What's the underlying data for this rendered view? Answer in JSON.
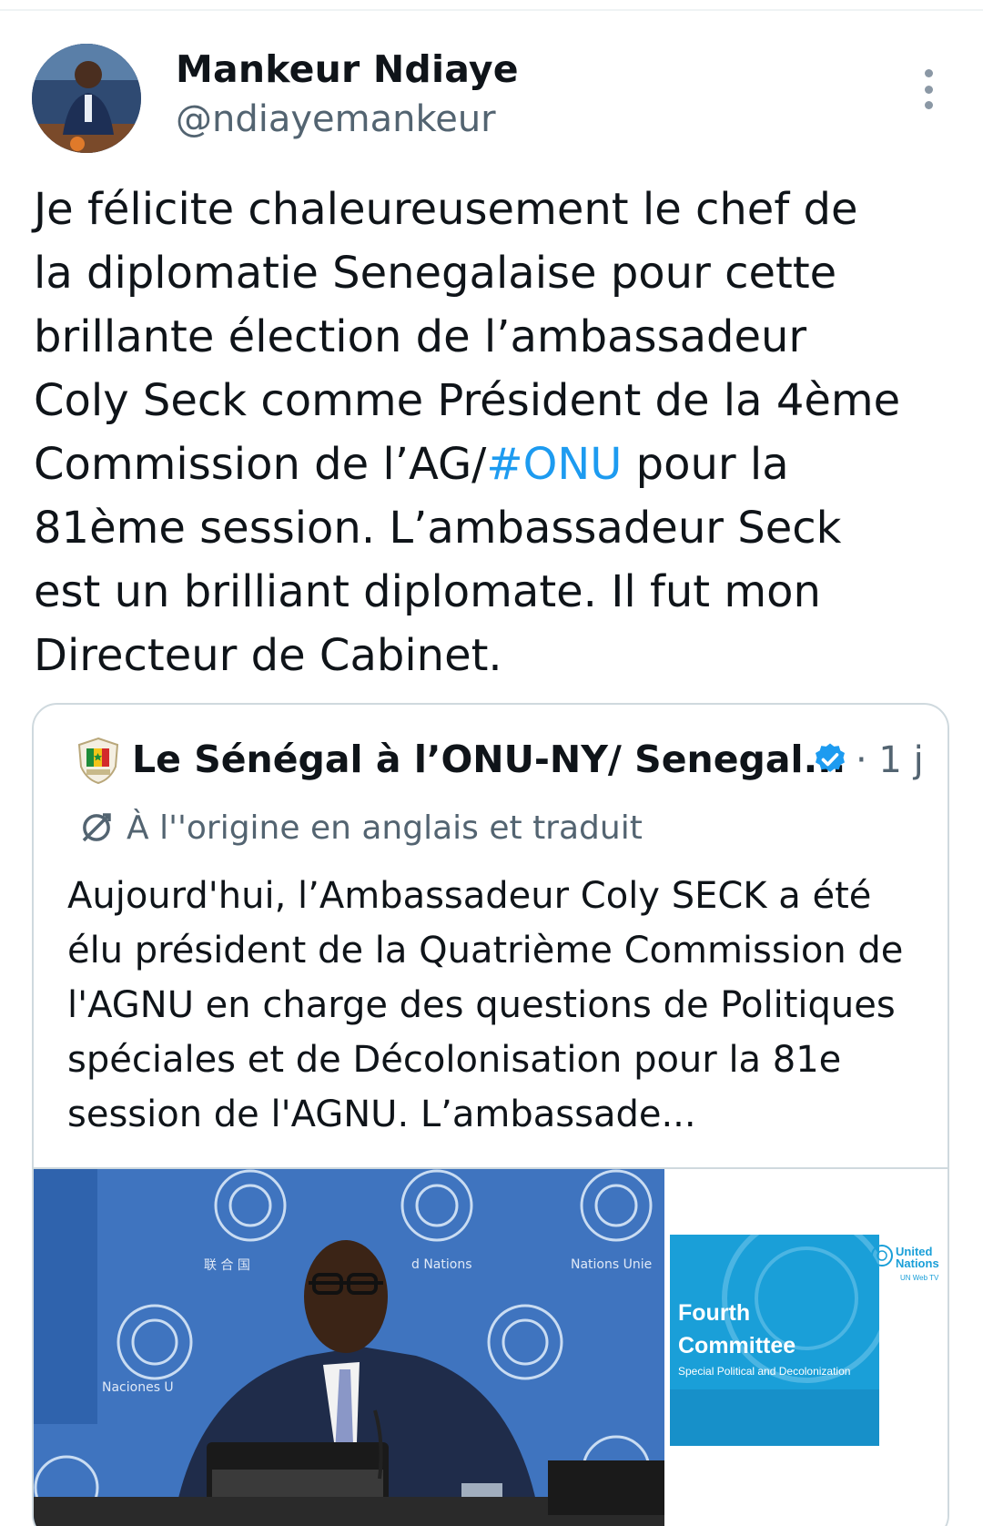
{
  "tweet": {
    "author_name": "Mankeur Ndiaye",
    "author_handle": "@ndiayemankeur",
    "more_icon": "more-vertical-icon",
    "text_before_hashtag": "Je félicite chaleureusement le chef de\nla diplomatie Senegalaise pour cette\nbrillante élection de l’ambassadeur\nColy Seck comme Président de la 4ème\nCommission de l’AG/",
    "hashtag": "#ONU",
    "text_after_hashtag": " pour la\n81ème session. L’ambassadeur Seck\nest un brilliant diplomate. Il fut mon\nDirecteur de Cabinet.",
    "hashtag_color": "#1d9bf0"
  },
  "quoted": {
    "account_name": "Le Sénégal à l’ONU-NY/ Senegal...",
    "verified_icon": "verified-badge-icon",
    "verified_color": "#1d9bf0",
    "time": "· 1 j",
    "translation_label": "À l''origine en anglais et traduit",
    "translation_icon": "translate-icon",
    "text": "Aujourd'hui, l’Ambassadeur Coly SECK a été élu président de la Quatrième Commission de l'AGNU en charge des questions de Politiques spéciales et de Décolonisation pour la 81e session de l'AGNU. L’ambassade...",
    "media": {
      "left_watermarks": [
        "联 合 国",
        "d Nations",
        "Nations Unie",
        "Naciones U"
      ],
      "right_title_line1": "Fourth",
      "right_title_line2": "Committee",
      "right_subtitle": "Special Political and Decolonization",
      "un_logo_line1": "United",
      "un_logo_line2": "Nations",
      "un_tv": "UN Web TV"
    }
  }
}
